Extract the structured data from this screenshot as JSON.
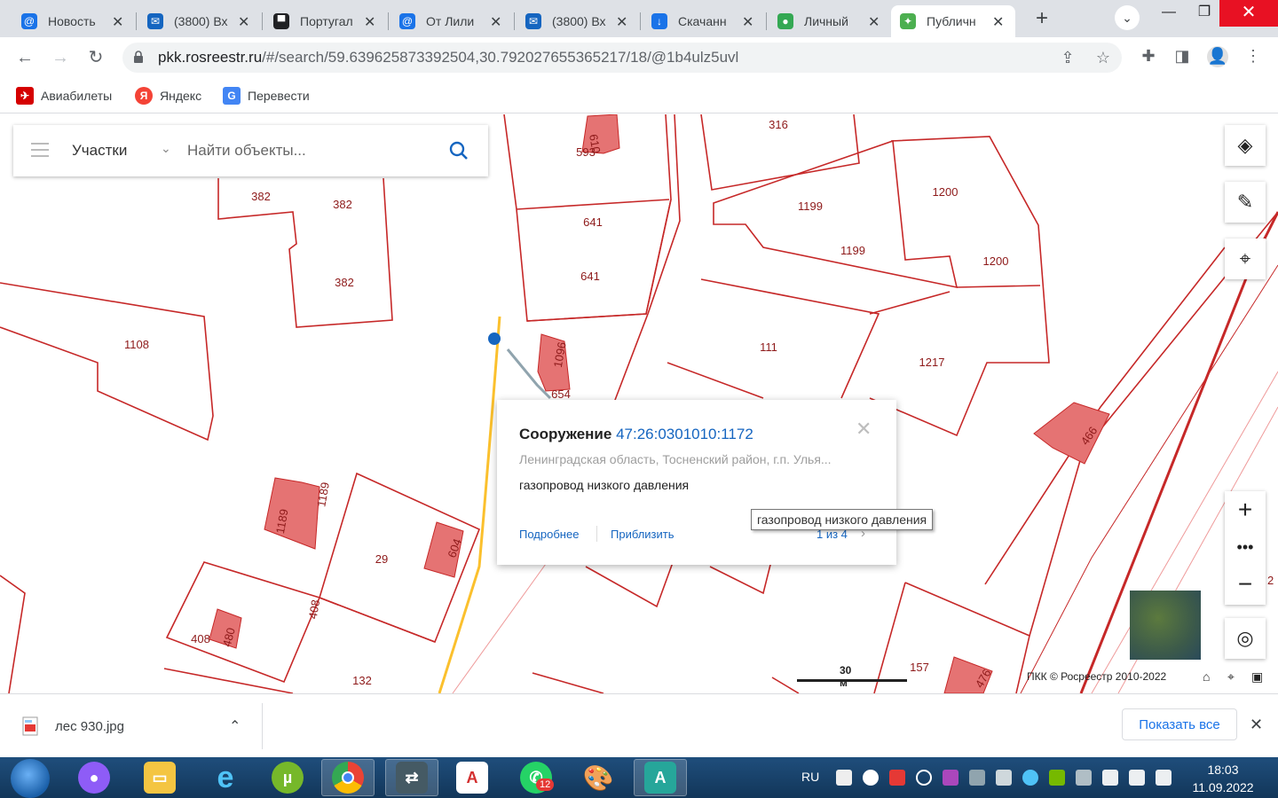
{
  "browser": {
    "tabs": [
      {
        "title": "Новость",
        "icon": "at-icon",
        "color": "#1a73e8"
      },
      {
        "title": "(3800) Вх",
        "icon": "mail-icon",
        "color": "#1565c0"
      },
      {
        "title": "Португал",
        "icon": "news-icon",
        "color": "#202124"
      },
      {
        "title": "От Лили",
        "icon": "at-icon",
        "color": "#1a73e8"
      },
      {
        "title": "(3800) Вх",
        "icon": "mail-icon",
        "color": "#1565c0"
      },
      {
        "title": "Скачанн",
        "icon": "download-icon",
        "color": "#1a73e8"
      },
      {
        "title": "Личный",
        "icon": "dots-icon",
        "color": "#34a853"
      },
      {
        "title": "Публичн",
        "icon": "pkk-icon",
        "color": "#4caf50"
      }
    ],
    "url_host": "pkk.rosreestr.ru",
    "url_path": "/#/search/59.639625873392504,30.792027655365217/18/@1b4ulz5uvl",
    "bookmarks": [
      {
        "label": "Авиабилеты",
        "icon": "tickets-icon",
        "color": "#d50000"
      },
      {
        "label": "Яндекс",
        "icon": "yandex-icon",
        "color": "#f44336"
      },
      {
        "label": "Перевести",
        "icon": "translate-icon",
        "color": "#4285f4"
      }
    ]
  },
  "map": {
    "search": {
      "category": "Участки",
      "placeholder": "Найти объекты..."
    },
    "parcels": [
      "593",
      "610",
      "316",
      "382",
      "382",
      "382",
      "641",
      "641",
      "1199",
      "1199",
      "1200",
      "1200",
      "1108",
      "1096",
      "654",
      "111",
      "1217",
      "466",
      "1189",
      "1189",
      "29",
      "604",
      "408",
      "480",
      "408",
      "132",
      "157",
      "476",
      "2"
    ],
    "popup": {
      "type": "Сооружение",
      "cadastral_number": "47:26:0301010:1172",
      "address": "Ленинградская область, Тосненский район, г.п. Улья...",
      "description": "газопровод низкого давления",
      "details_link": "Подробнее",
      "zoom_link": "Приблизить",
      "pager": "1 из 4"
    },
    "tooltip": "газопровод низкого давления",
    "scale": "30 м",
    "copyright": "ПКК © Росреестр 2010-2022"
  },
  "downloads": {
    "file_name": "лес 930.jpg",
    "show_all": "Показать все"
  },
  "taskbar": {
    "lang": "RU",
    "time": "18:03",
    "date": "11.09.2022",
    "whatsapp_badge": "12"
  }
}
